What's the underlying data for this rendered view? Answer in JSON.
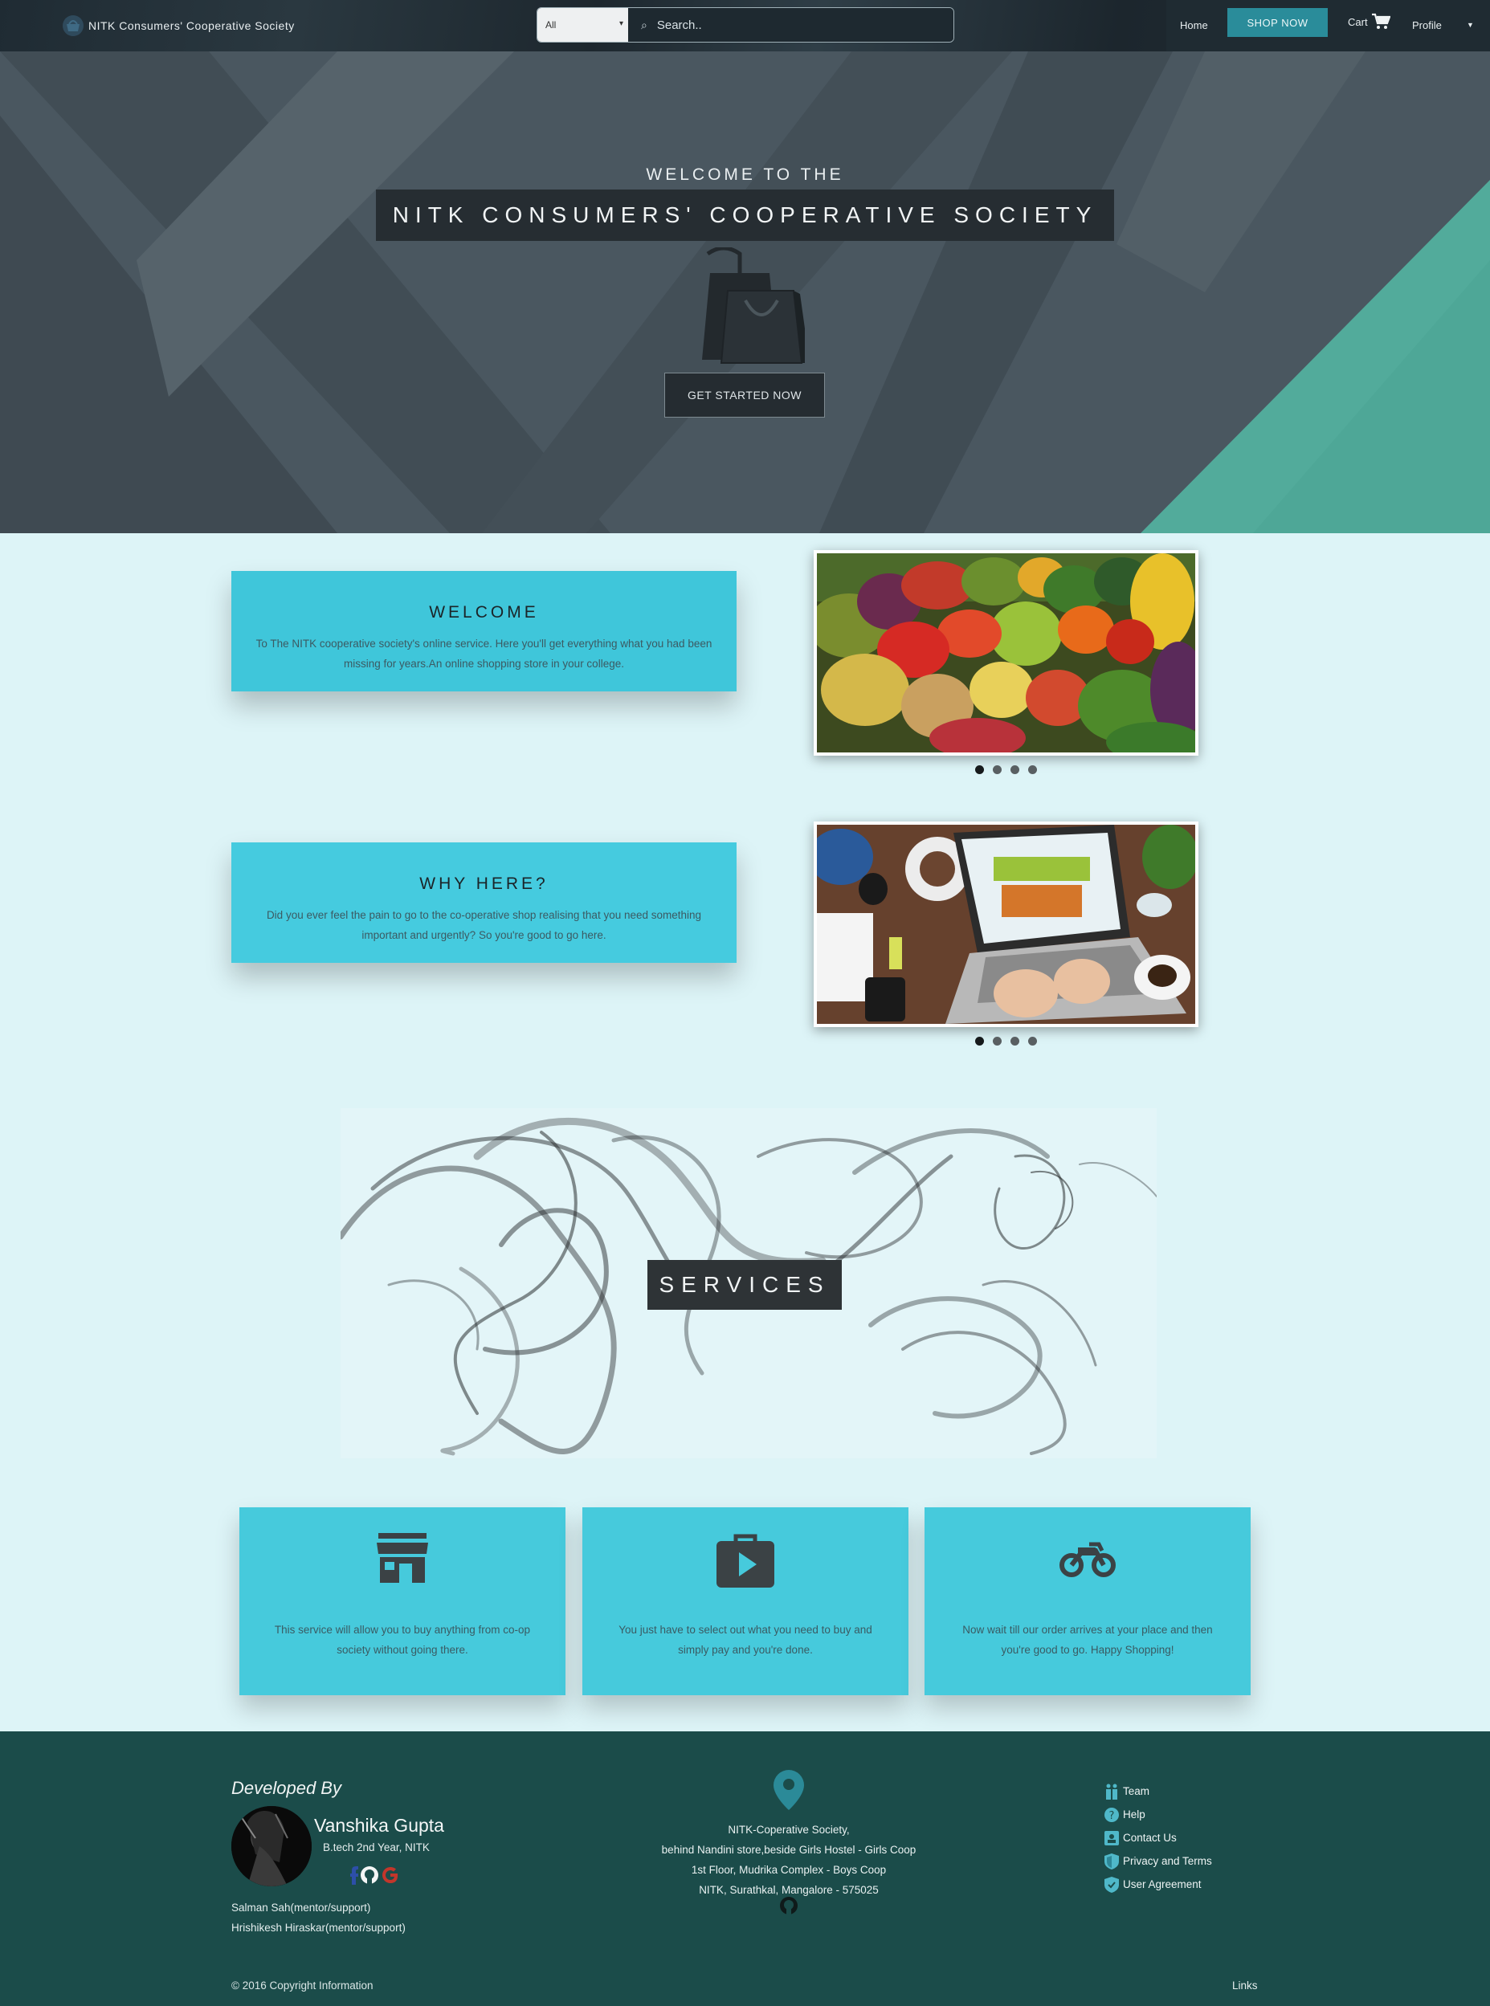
{
  "navbar": {
    "brand": "NITK Consumers' Cooperative Society",
    "search_category": "All",
    "search_placeholder": "Search..",
    "home": "Home",
    "shop_now": "SHOP NOW",
    "cart": "Cart",
    "profile": "Profile"
  },
  "hero": {
    "subtitle": "WELCOME TO THE",
    "title": "NITK CONSUMERS' COOPERATIVE SOCIETY",
    "cta": "GET STARTED NOW"
  },
  "sections": [
    {
      "heading": "WELCOME",
      "text": "To The NITK cooperative society's online service. Here you'll get everything what you had been missing for years.An online shopping store in your college.",
      "carousel_active": 1,
      "carousel_count": 4
    },
    {
      "heading": "WHY HERE?",
      "text": "Did you ever feel the pain to go to the co-operative shop realising that you need something important and urgently? So you're good to go here.",
      "carousel_active": 1,
      "carousel_count": 4
    }
  ],
  "services": {
    "title": "SERVICES",
    "cards": [
      {
        "icon": "store-icon",
        "text": "This service will allow you to buy anything from co-op society without going there."
      },
      {
        "icon": "briefcase-play-icon",
        "text": "You just have to select out what you need to buy and simply pay and you're done."
      },
      {
        "icon": "motorcycle-icon",
        "text": "Now wait till our order arrives at your place and then you're good to go. Happy Shopping!"
      }
    ]
  },
  "footer": {
    "developed_by": "Developed By",
    "developer_name": "Vanshika Gupta",
    "developer_role": "B.tech 2nd Year, NITK",
    "mentors": [
      "Salman Sah(mentor/support)",
      "Hrishikesh Hiraskar(mentor/support)"
    ],
    "address": [
      "NITK-Coperative Society,",
      "behind Nandini store,beside Girls Hostel - Girls Coop",
      "1st Floor, Mudrika Complex - Boys Coop",
      "NITK, Surathkal, Mangalore - 575025"
    ],
    "links": [
      {
        "icon": "team-icon",
        "label": "Team"
      },
      {
        "icon": "help-icon",
        "label": "Help"
      },
      {
        "icon": "contact-icon",
        "label": "Contact Us"
      },
      {
        "icon": "shield-icon",
        "label": "Privacy and Terms"
      },
      {
        "icon": "verified-shield-icon",
        "label": "User Agreement"
      }
    ],
    "copyright": "© 2016 Copyright Information",
    "links_label": "Links"
  },
  "colors": {
    "accent": "#2a8c9a",
    "card": "#46cadc",
    "footer": "#1b4c4a",
    "page_bg": "#ddf4f7"
  }
}
